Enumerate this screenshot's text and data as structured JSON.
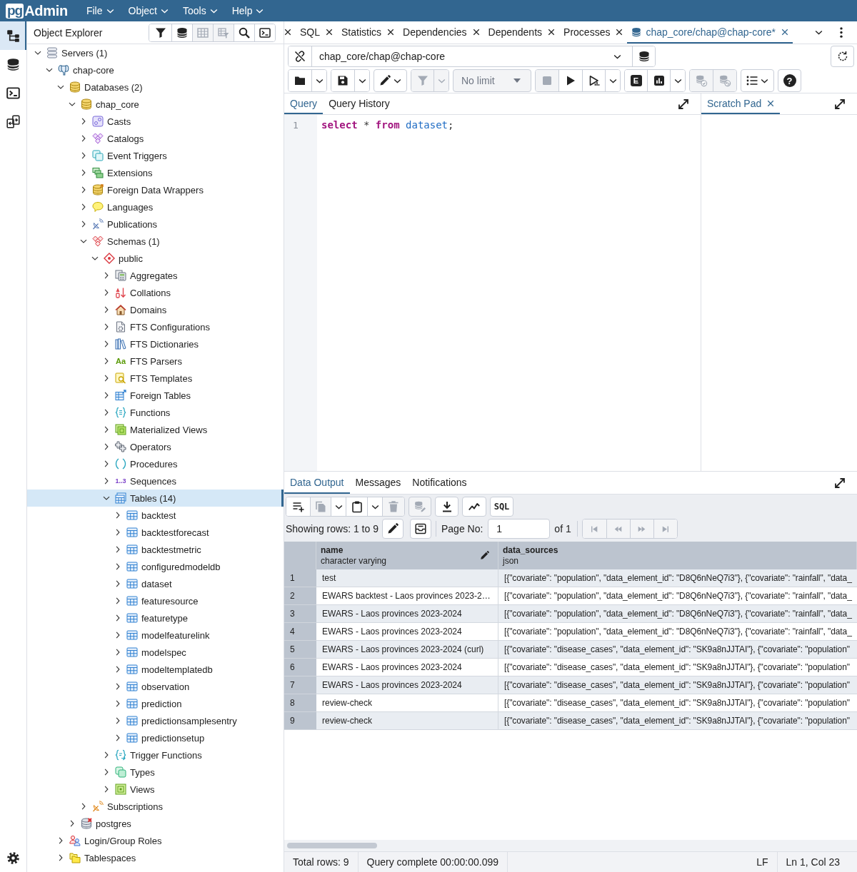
{
  "app_bar": {
    "logo_mark": "pg",
    "logo_text": "Admin",
    "menus": [
      "File",
      "Object",
      "Tools",
      "Help"
    ]
  },
  "tool_strip": [
    {
      "kind": "explorer",
      "selected": true
    },
    {
      "kind": "query",
      "selected": false
    },
    {
      "kind": "terminal",
      "selected": false
    },
    {
      "kind": "compare",
      "selected": false
    }
  ],
  "object_explorer": {
    "title": "Object Explorer",
    "tools": [
      {
        "kind": "filter",
        "disabled": false
      },
      {
        "kind": "query",
        "disabled": false
      },
      {
        "kind": "table",
        "disabled": true
      },
      {
        "kind": "table_filter",
        "disabled": true
      },
      {
        "kind": "search",
        "disabled": false
      },
      {
        "kind": "terminal",
        "disabled": false
      }
    ],
    "tree": [
      {
        "label": "Servers (1)",
        "kind": "servers",
        "expanded": true,
        "selected": false,
        "children": [
          {
            "label": "chap-core",
            "kind": "server",
            "expanded": true,
            "selected": false,
            "children": [
              {
                "label": "Databases (2)",
                "kind": "databases",
                "expanded": true,
                "selected": false,
                "children": [
                  {
                    "label": "chap_core",
                    "kind": "database",
                    "expanded": true,
                    "selected": false,
                    "children": [
                      {
                        "label": "Casts",
                        "kind": "casts",
                        "expanded": false,
                        "selected": false
                      },
                      {
                        "label": "Catalogs",
                        "kind": "catalogs",
                        "expanded": false,
                        "selected": false
                      },
                      {
                        "label": "Event Triggers",
                        "kind": "event_triggers",
                        "expanded": false,
                        "selected": false
                      },
                      {
                        "label": "Extensions",
                        "kind": "extensions",
                        "expanded": false,
                        "selected": false
                      },
                      {
                        "label": "Foreign Data Wrappers",
                        "kind": "foreign_data_wrappers",
                        "expanded": false,
                        "selected": false
                      },
                      {
                        "label": "Languages",
                        "kind": "languages",
                        "expanded": false,
                        "selected": false
                      },
                      {
                        "label": "Publications",
                        "kind": "publications",
                        "expanded": false,
                        "selected": false
                      },
                      {
                        "label": "Schemas (1)",
                        "kind": "schemas",
                        "expanded": true,
                        "selected": false,
                        "children": [
                          {
                            "label": "public",
                            "kind": "schema",
                            "expanded": true,
                            "selected": false,
                            "children": [
                              {
                                "label": "Aggregates",
                                "kind": "aggregates",
                                "expanded": false,
                                "selected": false
                              },
                              {
                                "label": "Collations",
                                "kind": "collations",
                                "expanded": false,
                                "selected": false
                              },
                              {
                                "label": "Domains",
                                "kind": "domains",
                                "expanded": false,
                                "selected": false
                              },
                              {
                                "label": "FTS Configurations",
                                "kind": "fts_configurations",
                                "expanded": false,
                                "selected": false
                              },
                              {
                                "label": "FTS Dictionaries",
                                "kind": "fts_dictionaries",
                                "expanded": false,
                                "selected": false
                              },
                              {
                                "label": "FTS Parsers",
                                "kind": "fts_parsers",
                                "glyph": "Aa",
                                "expanded": false,
                                "selected": false
                              },
                              {
                                "label": "FTS Templates",
                                "kind": "fts_templates",
                                "expanded": false,
                                "selected": false
                              },
                              {
                                "label": "Foreign Tables",
                                "kind": "foreign_tables",
                                "expanded": false,
                                "selected": false
                              },
                              {
                                "label": "Functions",
                                "kind": "functions",
                                "expanded": false,
                                "selected": false
                              },
                              {
                                "label": "Materialized Views",
                                "kind": "materialized_views",
                                "expanded": false,
                                "selected": false
                              },
                              {
                                "label": "Operators",
                                "kind": "operators",
                                "expanded": false,
                                "selected": false
                              },
                              {
                                "label": "Procedures",
                                "kind": "procedures",
                                "expanded": false,
                                "selected": false
                              },
                              {
                                "label": "Sequences",
                                "kind": "sequences",
                                "glyph": "1..3",
                                "expanded": false,
                                "selected": false
                              },
                              {
                                "label": "Tables (14)",
                                "kind": "tables",
                                "expanded": true,
                                "selected": true,
                                "children": [
                                  {
                                    "label": "backtest",
                                    "kind": "table",
                                    "expanded": false,
                                    "selected": false
                                  },
                                  {
                                    "label": "backtestforecast",
                                    "kind": "table",
                                    "expanded": false,
                                    "selected": false
                                  },
                                  {
                                    "label": "backtestmetric",
                                    "kind": "table",
                                    "expanded": false,
                                    "selected": false
                                  },
                                  {
                                    "label": "configuredmodeldb",
                                    "kind": "table",
                                    "expanded": false,
                                    "selected": false
                                  },
                                  {
                                    "label": "dataset",
                                    "kind": "table",
                                    "expanded": false,
                                    "selected": false
                                  },
                                  {
                                    "label": "featuresource",
                                    "kind": "table",
                                    "expanded": false,
                                    "selected": false
                                  },
                                  {
                                    "label": "featuretype",
                                    "kind": "table",
                                    "expanded": false,
                                    "selected": false
                                  },
                                  {
                                    "label": "modelfeaturelink",
                                    "kind": "table",
                                    "expanded": false,
                                    "selected": false
                                  },
                                  {
                                    "label": "modelspec",
                                    "kind": "table",
                                    "expanded": false,
                                    "selected": false
                                  },
                                  {
                                    "label": "modeltemplatedb",
                                    "kind": "table",
                                    "expanded": false,
                                    "selected": false
                                  },
                                  {
                                    "label": "observation",
                                    "kind": "table",
                                    "expanded": false,
                                    "selected": false
                                  },
                                  {
                                    "label": "prediction",
                                    "kind": "table",
                                    "expanded": false,
                                    "selected": false
                                  },
                                  {
                                    "label": "predictionsamplesentry",
                                    "kind": "table",
                                    "expanded": false,
                                    "selected": false
                                  },
                                  {
                                    "label": "predictionsetup",
                                    "kind": "table",
                                    "expanded": false,
                                    "selected": false
                                  }
                                ]
                              },
                              {
                                "label": "Trigger Functions",
                                "kind": "trigger_functions",
                                "expanded": false,
                                "selected": false
                              },
                              {
                                "label": "Types",
                                "kind": "types",
                                "expanded": false,
                                "selected": false
                              },
                              {
                                "label": "Views",
                                "kind": "views",
                                "expanded": false,
                                "selected": false
                              }
                            ]
                          }
                        ]
                      },
                      {
                        "label": "Subscriptions",
                        "kind": "subscriptions",
                        "expanded": false,
                        "selected": false
                      }
                    ]
                  },
                  {
                    "label": "postgres",
                    "kind": "database_disconnected",
                    "expanded": false,
                    "selected": false
                  }
                ]
              },
              {
                "label": "Login/Group Roles",
                "kind": "login_roles",
                "expanded": false,
                "selected": false
              },
              {
                "label": "Tablespaces",
                "kind": "tablespaces",
                "expanded": false,
                "selected": false
              }
            ]
          }
        ]
      }
    ]
  },
  "tabs": [
    {
      "kind": "panel",
      "selected": false
    },
    {
      "kind": "panel",
      "label": "SQL",
      "selected": false
    },
    {
      "kind": "panel",
      "label": "Statistics",
      "selected": false
    },
    {
      "kind": "panel",
      "label": "Dependencies",
      "selected": false
    },
    {
      "kind": "panel",
      "label": "Dependents",
      "selected": false
    },
    {
      "kind": "panel",
      "label": "Processes",
      "selected": false
    },
    {
      "kind": "query_tool",
      "label": "chap_core/chap@chap-core*",
      "selected": true
    }
  ],
  "connection": {
    "value": "chap_core/chap@chap-core"
  },
  "query_toolbar": [
    [
      {
        "kind": "open",
        "disabled": false
      },
      {
        "kind": "caret",
        "disabled": false
      }
    ],
    [
      {
        "kind": "save",
        "disabled": false
      },
      {
        "kind": "caret",
        "disabled": false
      }
    ],
    [
      {
        "kind": "edit_menu",
        "disabled": false
      }
    ],
    [
      {
        "kind": "filter",
        "disabled": true
      },
      {
        "kind": "caret",
        "disabled": true
      }
    ],
    [
      {
        "kind": "limit",
        "value": "No limit",
        "disabled": true
      }
    ],
    [
      {
        "kind": "stop",
        "disabled": true
      },
      {
        "kind": "execute",
        "disabled": false
      },
      {
        "kind": "explain",
        "disabled": false
      },
      {
        "kind": "caret",
        "disabled": false
      }
    ],
    [
      {
        "kind": "explain_analyze",
        "label": "E",
        "disabled": false
      },
      {
        "kind": "chart",
        "disabled": false
      },
      {
        "kind": "caret",
        "disabled": false
      }
    ],
    [
      {
        "kind": "commit",
        "disabled": true
      },
      {
        "kind": "rollback",
        "disabled": true
      }
    ],
    [
      {
        "kind": "macros_menu",
        "disabled": false
      }
    ],
    [
      {
        "kind": "help",
        "label": "?",
        "disabled": false
      }
    ]
  ],
  "query_panel": {
    "tabs": [
      {
        "label": "Query",
        "selected": true
      },
      {
        "label": "Query History",
        "selected": false
      }
    ],
    "lines": [
      {
        "number": "1",
        "tokens": [
          {
            "text": "select",
            "kind": "keyword"
          },
          {
            "text": " *",
            "kind": "operator"
          },
          {
            "text": " from",
            "kind": "keyword"
          },
          {
            "text": " dataset",
            "kind": "identifier"
          },
          {
            "text": ";",
            "kind": "punctuation"
          }
        ]
      }
    ]
  },
  "scratch_pad": {
    "tabs": [
      {
        "label": "Scratch Pad",
        "selected": true
      }
    ]
  },
  "results": {
    "tabs": [
      {
        "label": "Data Output",
        "selected": true
      },
      {
        "label": "Messages",
        "selected": false
      },
      {
        "label": "Notifications",
        "selected": false
      }
    ],
    "toolbar": [
      [
        {
          "kind": "add_row",
          "disabled": false
        },
        {
          "kind": "copy",
          "disabled": true
        },
        {
          "kind": "caret",
          "disabled": false
        },
        {
          "kind": "paste",
          "disabled": false
        },
        {
          "kind": "caret",
          "disabled": false
        },
        {
          "kind": "delete",
          "disabled": true
        }
      ],
      [
        {
          "kind": "save_data",
          "disabled": true
        }
      ],
      [
        {
          "kind": "download",
          "disabled": false
        }
      ],
      [
        {
          "kind": "graph",
          "disabled": false
        }
      ],
      [
        {
          "kind": "sql",
          "label": "SQL",
          "disabled": false
        }
      ]
    ]
  },
  "pagination": {
    "showing": "Showing rows: 1 to 9",
    "tools": [
      {
        "kind": "edit_range",
        "disabled": false
      },
      {
        "kind": "tray",
        "disabled": false
      }
    ],
    "page_label": "Page No:",
    "page": "1",
    "of": "of 1",
    "nav": [
      {
        "kind": "first",
        "disabled": true
      },
      {
        "kind": "previous",
        "disabled": true
      },
      {
        "kind": "next",
        "disabled": true
      },
      {
        "kind": "last",
        "disabled": true
      }
    ]
  },
  "grid": {
    "columns": [
      {
        "name": "name",
        "type": "character varying",
        "editable": true
      },
      {
        "name": "data_sources",
        "type": "json",
        "editable": false
      }
    ],
    "rows": [
      {
        "number": "1",
        "cells": [
          "test",
          "[{\"covariate\": \"population\", \"data_element_id\": \"D8Q6nNeQ7i3\"}, {\"covariate\": \"rainfall\", \"data_"
        ]
      },
      {
        "number": "2",
        "cells": [
          "EWARS backtest - Laos provinces 2023-2…",
          "[{\"covariate\": \"population\", \"data_element_id\": \"D8Q6nNeQ7i3\"}, {\"covariate\": \"rainfall\", \"data_"
        ]
      },
      {
        "number": "3",
        "cells": [
          "EWARS - Laos provinces 2023-2024",
          "[{\"covariate\": \"population\", \"data_element_id\": \"D8Q6nNeQ7i3\"}, {\"covariate\": \"rainfall\", \"data_"
        ]
      },
      {
        "number": "4",
        "cells": [
          "EWARS - Laos provinces 2023-2024",
          "[{\"covariate\": \"population\", \"data_element_id\": \"D8Q6nNeQ7i3\"}, {\"covariate\": \"rainfall\", \"data_"
        ]
      },
      {
        "number": "5",
        "cells": [
          "EWARS - Laos provinces 2023-2024 (curl)",
          "[{\"covariate\": \"disease_cases\", \"data_element_id\": \"SK9a8nJJTAI\"}, {\"covariate\": \"population\""
        ]
      },
      {
        "number": "6",
        "cells": [
          "EWARS - Laos provinces 2023-2024",
          "[{\"covariate\": \"disease_cases\", \"data_element_id\": \"SK9a8nJJTAI\"}, {\"covariate\": \"population\""
        ]
      },
      {
        "number": "7",
        "cells": [
          "EWARS - Laos provinces 2023-2024",
          "[{\"covariate\": \"disease_cases\", \"data_element_id\": \"SK9a8nJJTAI\"}, {\"covariate\": \"population\""
        ]
      },
      {
        "number": "8",
        "cells": [
          "review-check",
          "[{\"covariate\": \"disease_cases\", \"data_element_id\": \"SK9a8nJJTAI\"}, {\"covariate\": \"population\""
        ]
      },
      {
        "number": "9",
        "cells": [
          "review-check",
          "[{\"covariate\": \"disease_cases\", \"data_element_id\": \"SK9a8nJJTAI\"}, {\"covariate\": \"population\""
        ]
      }
    ]
  },
  "status_bar": {
    "total": "Total rows: 9",
    "message": "Query complete 00:00:00.099",
    "eol": "LF",
    "cursor": "Ln 1, Col 23"
  }
}
